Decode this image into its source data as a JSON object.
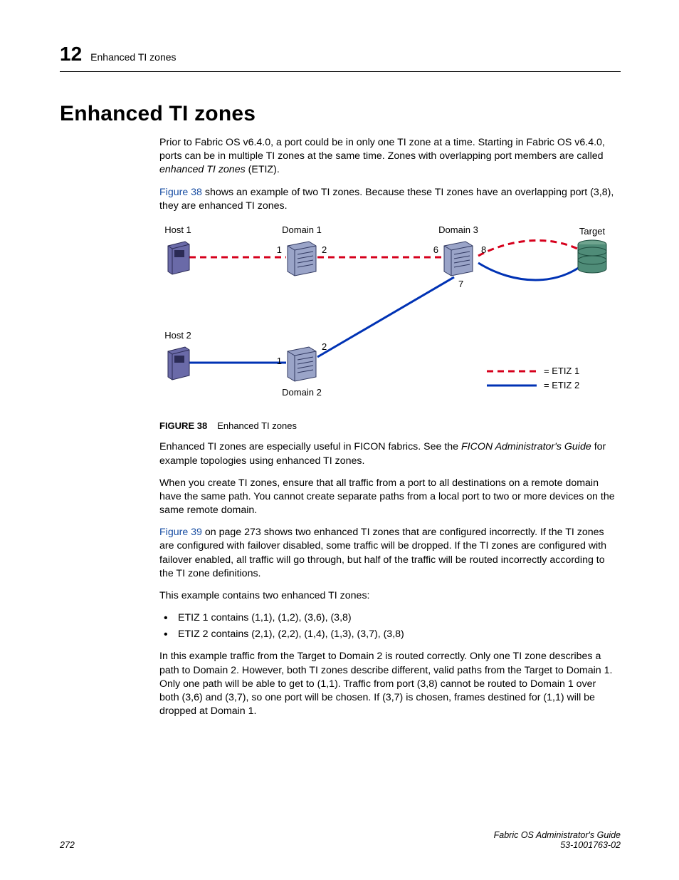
{
  "header": {
    "chapter_number": "12",
    "running_title": "Enhanced TI zones"
  },
  "section_title": "Enhanced TI zones",
  "paragraphs": {
    "p1_a": "Prior to Fabric OS v6.4.0, a port could be in only one TI zone at a time. Starting in Fabric OS v6.4.0, ports can be in multiple TI zones at the same time. Zones with overlapping port members are called ",
    "p1_em": "enhanced TI zones",
    "p1_b": " (ETIZ).",
    "p2_link": "Figure 38",
    "p2_rest": " shows an example of two TI zones. Because these TI zones have an overlapping port (3,8), they are enhanced TI zones.",
    "p3_a": "Enhanced TI zones are especially useful in FICON fabrics. See the ",
    "p3_em": "FICON Administrator's Guide",
    "p3_b": " for example topologies using enhanced TI zones.",
    "p4": "When you create TI zones, ensure that all traffic from a port to all destinations on a remote domain have the same path. You cannot create separate paths from a local port to two or more devices on the same remote domain.",
    "p5_link": "Figure 39",
    "p5_rest": " on page 273 shows two enhanced TI zones that are configured incorrectly. If the TI zones are configured with failover disabled, some traffic will be dropped. If the TI zones are configured with failover enabled, all traffic will go through, but half of the traffic will be routed incorrectly according to the TI zone definitions.",
    "p6": "This example contains two enhanced TI zones:",
    "li1": "ETIZ 1 contains (1,1), (1,2), (3,6), (3,8)",
    "li2": "ETIZ 2 contains (2,1), (2,2), (1,4), (1,3), (3,7), (3,8)",
    "p7": "In this example traffic from the Target to Domain 2 is routed correctly. Only one TI zone describes a path to Domain 2. However, both TI zones describe different, valid paths from the Target to Domain 1. Only one path will be able to get to (1,1). Traffic from port (3,8) cannot be routed to Domain 1 over both (3,6) and (3,7), so one port will be chosen. If (3,7) is chosen, frames destined for (1,1) will be dropped at Domain 1."
  },
  "figure": {
    "number": "FIGURE 38",
    "caption": "Enhanced TI zones",
    "labels": {
      "host1": "Host 1",
      "host2": "Host 2",
      "domain1": "Domain 1",
      "domain2": "Domain 2",
      "domain3": "Domain 3",
      "target": "Target",
      "port1a": "1",
      "port2a": "2",
      "port6": "6",
      "port8": "8",
      "port7": "7",
      "port1b": "1",
      "port2b": "2",
      "legend1": "= ETIZ 1",
      "legend2": "= ETIZ 2"
    }
  },
  "footer": {
    "page": "272",
    "doc_title": "Fabric OS Administrator's Guide",
    "doc_id": "53-1001763-02"
  }
}
